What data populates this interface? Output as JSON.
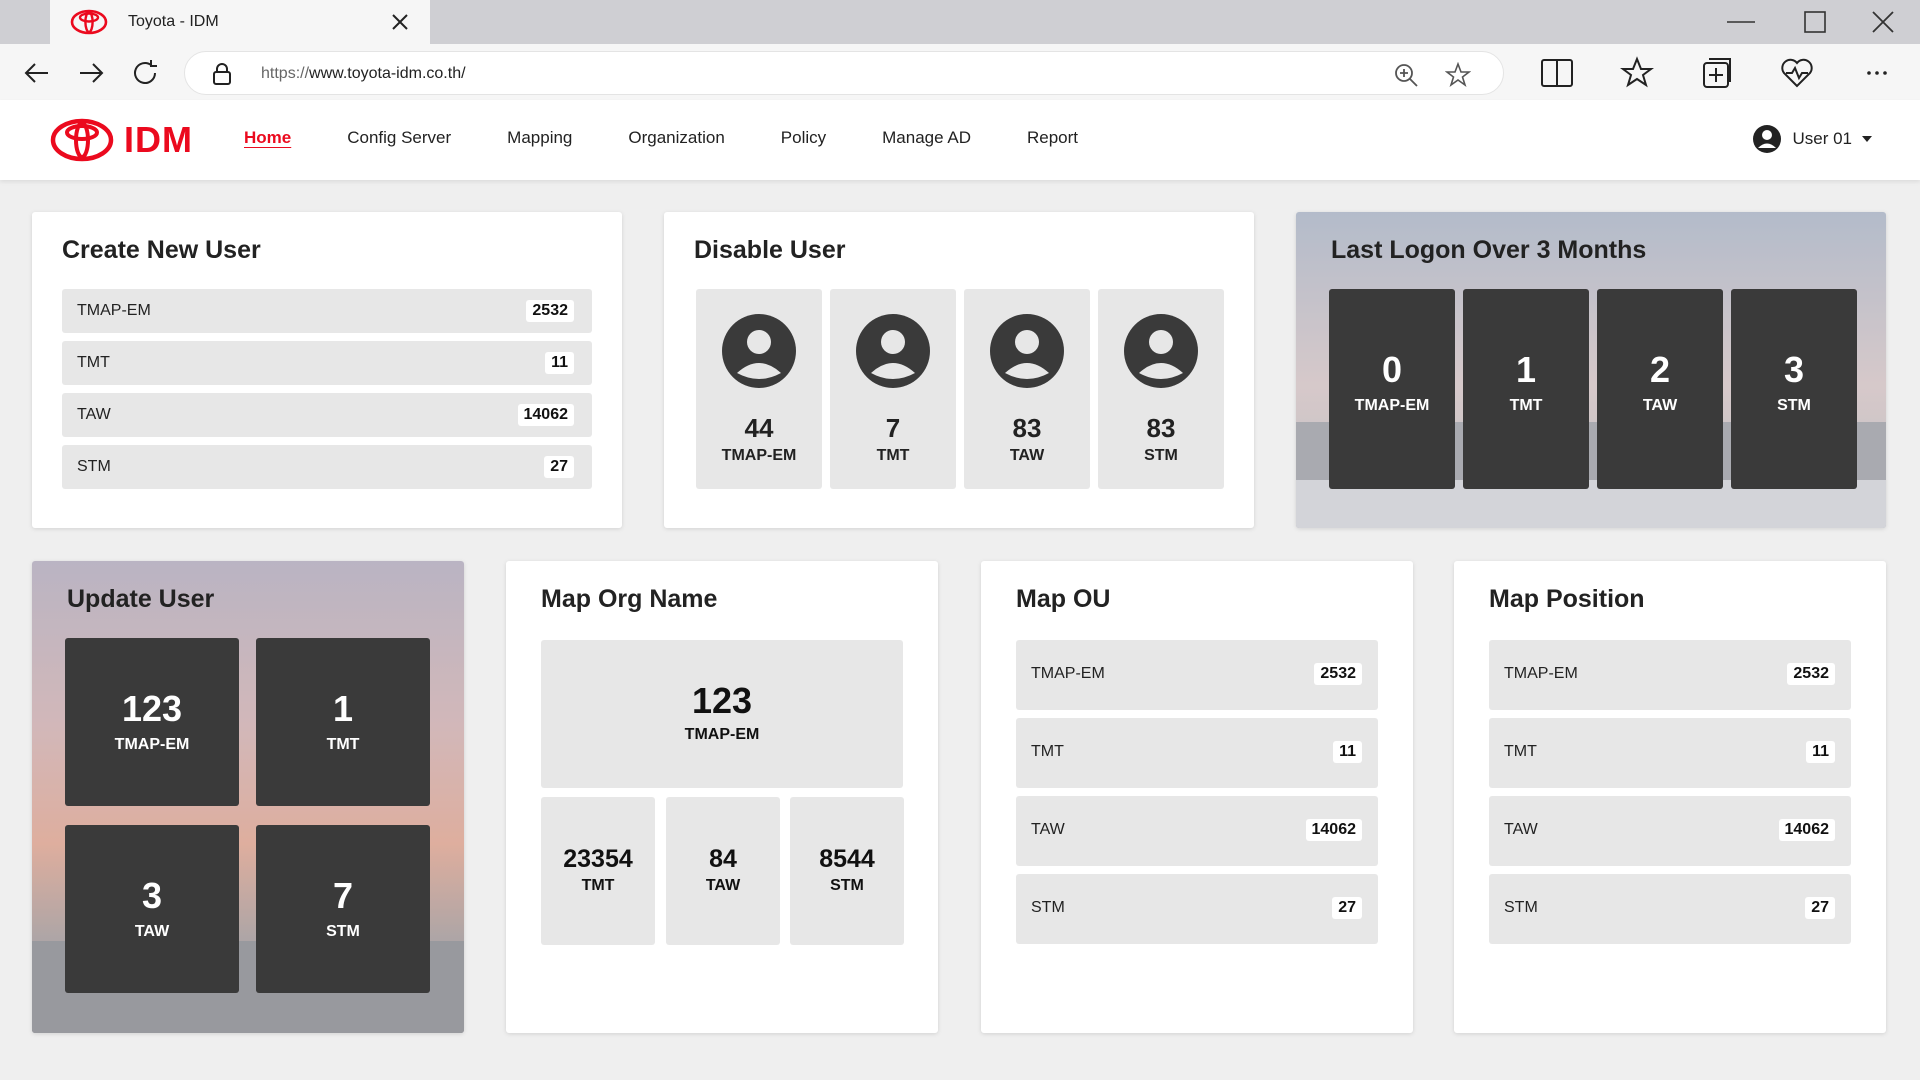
{
  "browser": {
    "tab_title": "Toyota - IDM",
    "url_scheme": "https://",
    "url_host": "www.toyota-idm.co.th/"
  },
  "header": {
    "brand": "IDM",
    "nav": [
      "Home",
      "Config Server",
      "Mapping",
      "Organization",
      "Policy",
      "Manage AD",
      "Report"
    ],
    "active_nav": "Home",
    "user": "User 01"
  },
  "colors": {
    "accent": "#eb0a1e",
    "tile_dark": "#3a3a3a",
    "tile_light": "#e7e7e7",
    "page_bg": "#efefef"
  },
  "create_new_user": {
    "title": "Create New User",
    "rows": [
      {
        "label": "TMAP-EM",
        "value": "2532"
      },
      {
        "label": "TMT",
        "value": "11"
      },
      {
        "label": "TAW",
        "value": "14062"
      },
      {
        "label": "STM",
        "value": "27"
      }
    ]
  },
  "disable_user": {
    "title": "Disable User",
    "tiles": [
      {
        "value": "44",
        "label": "TMAP-EM"
      },
      {
        "value": "7",
        "label": "TMT"
      },
      {
        "value": "83",
        "label": "TAW"
      },
      {
        "value": "83",
        "label": "STM"
      }
    ]
  },
  "last_logon": {
    "title": "Last Logon Over 3 Months",
    "tiles": [
      {
        "value": "0",
        "label": "TMAP-EM"
      },
      {
        "value": "1",
        "label": "TMT"
      },
      {
        "value": "2",
        "label": "TAW"
      },
      {
        "value": "3",
        "label": "STM"
      }
    ]
  },
  "update_user": {
    "title": "Update User",
    "tiles": [
      {
        "value": "123",
        "label": "TMAP-EM"
      },
      {
        "value": "1",
        "label": "TMT"
      },
      {
        "value": "3",
        "label": "TAW"
      },
      {
        "value": "7",
        "label": "STM"
      }
    ]
  },
  "map_org_name": {
    "title": "Map Org Name",
    "main": {
      "value": "123",
      "label": "TMAP-EM"
    },
    "tiles": [
      {
        "value": "23354",
        "label": "TMT"
      },
      {
        "value": "84",
        "label": "TAW"
      },
      {
        "value": "8544",
        "label": "STM"
      }
    ]
  },
  "map_ou": {
    "title": "Map OU",
    "rows": [
      {
        "label": "TMAP-EM",
        "value": "2532"
      },
      {
        "label": "TMT",
        "value": "11"
      },
      {
        "label": "TAW",
        "value": "14062"
      },
      {
        "label": "STM",
        "value": "27"
      }
    ]
  },
  "map_position": {
    "title": "Map Position",
    "rows": [
      {
        "label": "TMAP-EM",
        "value": "2532"
      },
      {
        "label": "TMT",
        "value": "11"
      },
      {
        "label": "TAW",
        "value": "14062"
      },
      {
        "label": "STM",
        "value": "27"
      }
    ]
  },
  "icons": [
    "toyota-logo-icon",
    "close-icon",
    "minimize-icon",
    "maximize-icon",
    "back-icon",
    "forward-icon",
    "refresh-icon",
    "lock-icon",
    "zoom-icon",
    "star-icon",
    "split-screen-icon",
    "favorites-icon",
    "collections-icon",
    "health-icon",
    "more-icon",
    "user-avatar-icon",
    "caret-down-icon"
  ]
}
